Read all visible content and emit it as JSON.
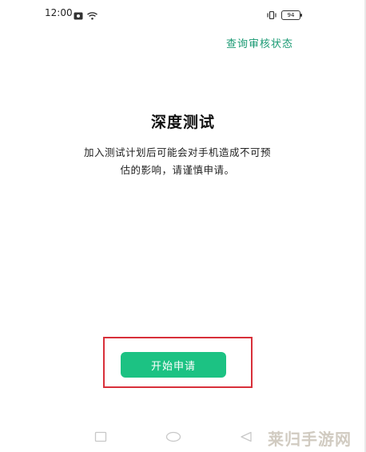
{
  "status_bar": {
    "time": "12:00",
    "battery": "94"
  },
  "header": {
    "query_status_link": "查询审核状态"
  },
  "main": {
    "title": "深度测试",
    "description_line1": "加入测试计划后可能会对手机造成不可预",
    "description_line2": "估的影响，请谨慎申请。",
    "apply_button": "开始申请"
  },
  "nav": {
    "icons": [
      "recent-apps-icon",
      "home-icon",
      "back-icon"
    ]
  },
  "watermark": "莱归手游网",
  "colors": {
    "accent": "#1cc283",
    "link": "#1a9a73",
    "highlight": "#d8303a"
  }
}
